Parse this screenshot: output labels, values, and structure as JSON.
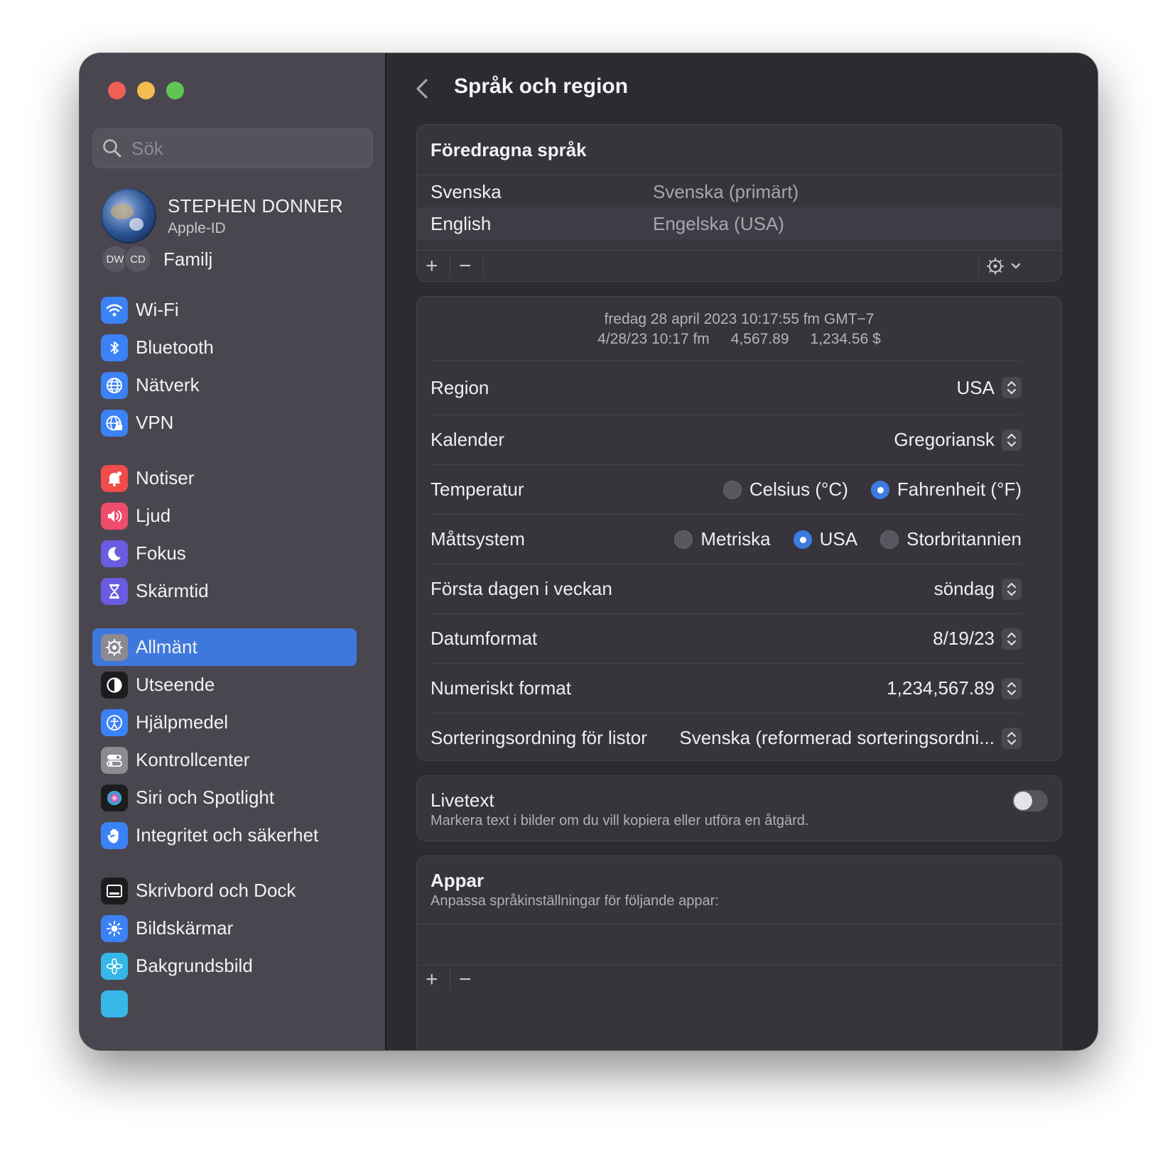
{
  "search": {
    "placeholder": "Sök"
  },
  "profile": {
    "name": "STEPHEN DONNER",
    "subtitle": "Apple-ID"
  },
  "family": {
    "badges": [
      "DW",
      "CD"
    ],
    "label": "Familj"
  },
  "sidebar": {
    "items": [
      {
        "label": "Wi-Fi",
        "icon": "wifi-icon",
        "color": "#3b82f6"
      },
      {
        "label": "Bluetooth",
        "icon": "bluetooth-icon",
        "color": "#3b82f6"
      },
      {
        "label": "Nätverk",
        "icon": "globe-icon",
        "color": "#3b82f6"
      },
      {
        "label": "VPN",
        "icon": "vpn-globe-icon",
        "color": "#3b82f6"
      },
      {
        "label": "Notiser",
        "icon": "bell-icon",
        "color": "#ef4c4a"
      },
      {
        "label": "Ljud",
        "icon": "speaker-icon",
        "color": "#ef4c6b"
      },
      {
        "label": "Fokus",
        "icon": "moon-icon",
        "color": "#6a5ce0"
      },
      {
        "label": "Skärmtid",
        "icon": "hourglass-icon",
        "color": "#6a5ce0"
      },
      {
        "label": "Allmänt",
        "icon": "gear-icon",
        "color": "#8d8a92",
        "active": true
      },
      {
        "label": "Utseende",
        "icon": "appearance-icon",
        "color": "#1c1c1e"
      },
      {
        "label": "Hjälpmedel",
        "icon": "accessibility-icon",
        "color": "#3b82f6"
      },
      {
        "label": "Kontrollcenter",
        "icon": "toggles-icon",
        "color": "#8d8a92"
      },
      {
        "label": "Siri och Spotlight",
        "icon": "siri-icon",
        "color": "#1c1c1e"
      },
      {
        "label": "Integritet och säkerhet",
        "icon": "hand-icon",
        "color": "#3b82f6"
      },
      {
        "label": "Skrivbord och Dock",
        "icon": "dock-icon",
        "color": "#1c1c1e"
      },
      {
        "label": "Bildskärmar",
        "icon": "sun-icon",
        "color": "#3b82f6"
      },
      {
        "label": "Bakgrundsbild",
        "icon": "flower-icon",
        "color": "#35b7e8"
      }
    ]
  },
  "main": {
    "title": "Språk och region",
    "preferred": {
      "title": "Föredragna språk",
      "languages": [
        {
          "name": "Svenska",
          "desc": "Svenska (primärt)"
        },
        {
          "name": "English",
          "desc": "Engelska (USA)"
        }
      ],
      "add": "+",
      "remove": "−"
    },
    "preview": {
      "line1": "fredag 28 april 2023 10:17:55 fm GMT−7",
      "date_short": "4/28/23 10:17 fm",
      "number": "4,567.89",
      "currency": "1,234.56 $"
    },
    "settings": {
      "region": {
        "label": "Region",
        "value": "USA"
      },
      "calendar": {
        "label": "Kalender",
        "value": "Gregoriansk"
      },
      "temperature": {
        "label": "Temperatur",
        "options": [
          "Celsius (°C)",
          "Fahrenheit (°F)"
        ],
        "selected": "Fahrenheit (°F)"
      },
      "measurement": {
        "label": "Måttsystem",
        "options": [
          "Metriska",
          "USA",
          "Storbritannien"
        ],
        "selected": "USA"
      },
      "first_day": {
        "label": "Första dagen i veckan",
        "value": "söndag"
      },
      "date_format": {
        "label": "Datumformat",
        "value": "8/19/23"
      },
      "number_format": {
        "label": "Numeriskt format",
        "value": "1,234,567.89"
      },
      "sort_order": {
        "label": "Sorteringsordning för listor",
        "value": "Svenska (reformerad sorteringsordni..."
      }
    },
    "livetext": {
      "title": "Livetext",
      "desc": "Markera text i bilder om du vill kopiera eller utföra en åtgärd.",
      "enabled": false
    },
    "apps": {
      "title": "Appar",
      "desc": "Anpassa språkinställningar för följande appar:",
      "add": "+",
      "remove": "−"
    }
  }
}
